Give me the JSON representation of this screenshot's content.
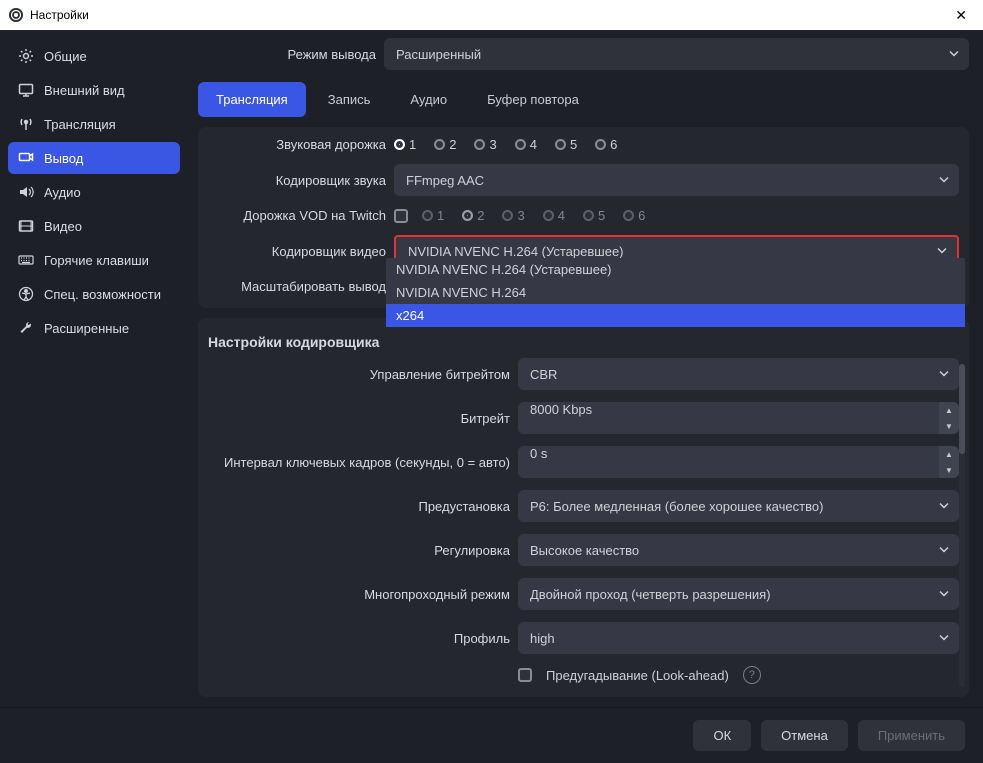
{
  "window": {
    "title": "Настройки"
  },
  "sidebar": {
    "items": [
      {
        "label": "Общие"
      },
      {
        "label": "Внешний вид"
      },
      {
        "label": "Трансляция"
      },
      {
        "label": "Вывод"
      },
      {
        "label": "Аудио"
      },
      {
        "label": "Видео"
      },
      {
        "label": "Горячие клавиши"
      },
      {
        "label": "Спец. возможности"
      },
      {
        "label": "Расширенные"
      }
    ]
  },
  "output_mode": {
    "label": "Режим вывода",
    "value": "Расширенный"
  },
  "tabs": [
    {
      "label": "Трансляция"
    },
    {
      "label": "Запись"
    },
    {
      "label": "Аудио"
    },
    {
      "label": "Буфер повтора"
    }
  ],
  "audio_track": {
    "label": "Звуковая дорожка",
    "options": [
      "1",
      "2",
      "3",
      "4",
      "5",
      "6"
    ]
  },
  "audio_encoder": {
    "label": "Кодировщик звука",
    "value": "FFmpeg AAC"
  },
  "vod_track": {
    "label": "Дорожка VOD на Twitch",
    "options": [
      "1",
      "2",
      "3",
      "4",
      "5",
      "6"
    ]
  },
  "video_encoder": {
    "label": "Кодировщик видео",
    "value": "NVIDIA NVENC H.264 (Устаревшее)",
    "options": [
      "NVIDIA NVENC H.264 (Устаревшее)",
      "NVIDIA NVENC H.264",
      "x264"
    ]
  },
  "rescale": {
    "label": "Масштабировать вывод"
  },
  "encoder_section": {
    "title": "Настройки кодировщика"
  },
  "rate_control": {
    "label": "Управление битрейтом",
    "value": "CBR"
  },
  "bitrate": {
    "label": "Битрейт",
    "value": "8000 Kbps"
  },
  "keyframe": {
    "label": "Интервал ключевых кадров (секунды, 0 = авто)",
    "value": "0 s"
  },
  "preset": {
    "label": "Предустановка",
    "value": "P6: Более медленная (более хорошее качество)"
  },
  "tuning": {
    "label": "Регулировка",
    "value": "Высокое качество"
  },
  "multipass": {
    "label": "Многопроходный режим",
    "value": "Двойной проход (четверть разрешения)"
  },
  "profile": {
    "label": "Профиль",
    "value": "high"
  },
  "lookahead": {
    "label": "Предугадывание (Look-ahead)"
  },
  "footer": {
    "ok": "ОК",
    "cancel": "Отмена",
    "apply": "Применить"
  }
}
